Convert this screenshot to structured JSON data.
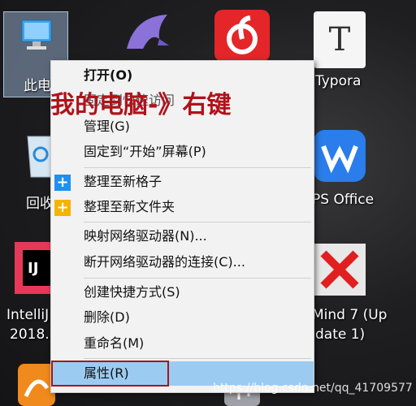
{
  "desktop": {
    "icons": [
      {
        "label": "此电",
        "icon": "this-pc-icon"
      },
      {
        "label": "Typora",
        "icon": "typora-icon"
      },
      {
        "label": "回收",
        "icon": "recycle-bin-icon"
      },
      {
        "label": "PS Office",
        "icon": "wps-office-icon"
      },
      {
        "label": "IntelliJ",
        "label2": "2018.",
        "icon": "intellij-icon"
      },
      {
        "label": "Mind 7 (Up",
        "label2": "date 1)",
        "icon": "xmind-icon"
      }
    ]
  },
  "context_menu": {
    "items": [
      {
        "label": "打开(O)",
        "bold": true
      },
      {
        "label": "固定到快速访问"
      },
      {
        "label": "管理(G)"
      },
      {
        "label": "固定到“开始”屏幕(P)"
      },
      {
        "label": "整理至新格子",
        "icon": "plus-blue-icon"
      },
      {
        "label": "整理至新文件夹",
        "icon": "plus-yellow-icon"
      },
      {
        "label": "映射网络驱动器(N)..."
      },
      {
        "label": "断开网络驱动器的连接(C)..."
      },
      {
        "label": "创建快捷方式(S)"
      },
      {
        "label": "删除(D)"
      },
      {
        "label": "重命名(M)"
      },
      {
        "label": "属性(R)"
      }
    ]
  },
  "annotation": "我的电脑-》右键",
  "watermark": "https://blog.csdn.net/qq_41709577",
  "colors": {
    "menu_bg": "#f2f2f2",
    "hover": "#9ccbf2",
    "annotation": "#b0121b"
  }
}
